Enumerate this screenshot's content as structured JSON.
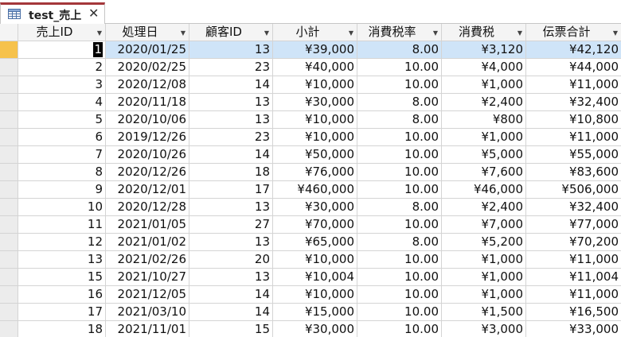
{
  "tab": {
    "title": "test_売上",
    "close": "✕"
  },
  "columns": [
    "売上ID",
    "処理日",
    "顧客ID",
    "小計",
    "消費税率",
    "消費税",
    "伝票合計"
  ],
  "dropdown_glyph": "▼",
  "current_row_index": 0,
  "rows": [
    [
      "1",
      "2020/01/25",
      "13",
      "¥39,000",
      "8.00",
      "¥3,120",
      "¥42,120"
    ],
    [
      "2",
      "2020/02/25",
      "23",
      "¥40,000",
      "10.00",
      "¥4,000",
      "¥44,000"
    ],
    [
      "3",
      "2020/12/08",
      "14",
      "¥10,000",
      "10.00",
      "¥1,000",
      "¥11,000"
    ],
    [
      "4",
      "2020/11/18",
      "13",
      "¥30,000",
      "8.00",
      "¥2,400",
      "¥32,400"
    ],
    [
      "5",
      "2020/10/06",
      "13",
      "¥10,000",
      "8.00",
      "¥800",
      "¥10,800"
    ],
    [
      "6",
      "2019/12/26",
      "23",
      "¥10,000",
      "10.00",
      "¥1,000",
      "¥11,000"
    ],
    [
      "7",
      "2020/10/26",
      "14",
      "¥50,000",
      "10.00",
      "¥5,000",
      "¥55,000"
    ],
    [
      "8",
      "2020/12/26",
      "18",
      "¥76,000",
      "10.00",
      "¥7,600",
      "¥83,600"
    ],
    [
      "9",
      "2020/12/01",
      "17",
      "¥460,000",
      "10.00",
      "¥46,000",
      "¥506,000"
    ],
    [
      "10",
      "2020/12/28",
      "13",
      "¥30,000",
      "8.00",
      "¥2,400",
      "¥32,400"
    ],
    [
      "11",
      "2021/01/05",
      "27",
      "¥70,000",
      "10.00",
      "¥7,000",
      "¥77,000"
    ],
    [
      "12",
      "2021/01/02",
      "13",
      "¥65,000",
      "8.00",
      "¥5,200",
      "¥70,200"
    ],
    [
      "13",
      "2021/02/26",
      "20",
      "¥10,000",
      "10.00",
      "¥1,000",
      "¥11,000"
    ],
    [
      "15",
      "2021/10/27",
      "13",
      "¥10,004",
      "10.00",
      "¥1,000",
      "¥11,004"
    ],
    [
      "16",
      "2021/12/05",
      "14",
      "¥10,000",
      "10.00",
      "¥1,000",
      "¥11,000"
    ],
    [
      "17",
      "2021/03/10",
      "14",
      "¥15,000",
      "10.00",
      "¥1,500",
      "¥16,500"
    ],
    [
      "18",
      "2021/11/01",
      "15",
      "¥30,000",
      "10.00",
      "¥3,000",
      "¥33,000"
    ]
  ]
}
